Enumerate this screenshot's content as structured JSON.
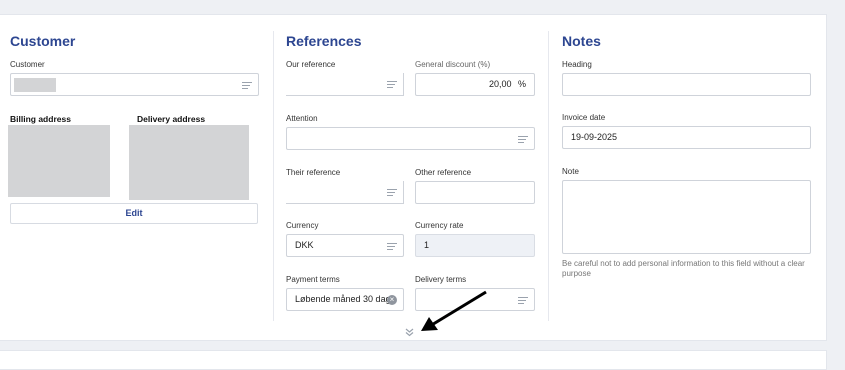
{
  "customer_section": {
    "title": "Customer",
    "customer_label": "Customer",
    "billing_label": "Billing address",
    "delivery_label": "Delivery address",
    "edit_label": "Edit"
  },
  "references_section": {
    "title": "References",
    "our_reference_label": "Our reference",
    "our_reference_value": "",
    "general_discount_label": "General discount (%)",
    "general_discount_value": "20,00",
    "percent_unit": "%",
    "attention_label": "Attention",
    "attention_value": "",
    "their_reference_label": "Their reference",
    "their_reference_value": "",
    "other_reference_label": "Other reference",
    "other_reference_value": "",
    "currency_label": "Currency",
    "currency_value": "DKK",
    "currency_rate_label": "Currency rate",
    "currency_rate_value": "1",
    "payment_terms_label": "Payment terms",
    "payment_terms_value": "Løbende måned 30 dage",
    "delivery_terms_label": "Delivery terms",
    "delivery_terms_value": ""
  },
  "notes_section": {
    "title": "Notes",
    "heading_label": "Heading",
    "heading_value": "",
    "invoice_date_label": "Invoice date",
    "invoice_date_value": "19-09-2025",
    "note_label": "Note",
    "note_value": "",
    "note_hint": "Be careful not to add personal information to this field without a clear purpose"
  },
  "icons": {
    "list": "list-lines-icon",
    "clear": "clear-x-icon",
    "expand": "chevron-double-down-icon",
    "arrow": "pointer-arrow-annotation"
  }
}
